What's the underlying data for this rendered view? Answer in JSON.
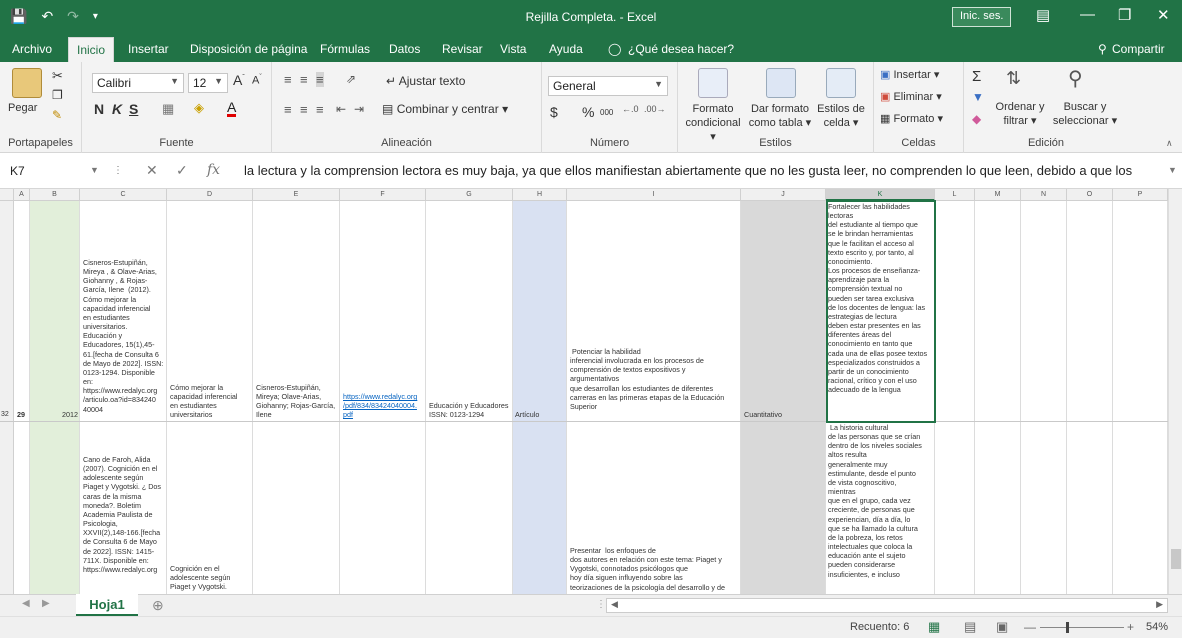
{
  "window": {
    "title": "Rejilla Completa. - Excel",
    "signin": "Inic. ses.",
    "share": "Compartir"
  },
  "tabs": [
    "Archivo",
    "Inicio",
    "Insertar",
    "Disposición de página",
    "Fórmulas",
    "Datos",
    "Revisar",
    "Vista",
    "Ayuda"
  ],
  "tellme": "¿Qué desea hacer?",
  "ribbon": {
    "clipboard": {
      "paste": "Pegar",
      "label": "Portapapeles"
    },
    "font": {
      "name": "Calibri",
      "size": "12",
      "bold": "N",
      "italic": "K",
      "underline": "S",
      "label": "Fuente"
    },
    "alignment": {
      "wrap": "Ajustar texto",
      "merge": "Combinar y centrar",
      "label": "Alineación"
    },
    "number": {
      "format": "General",
      "currency": "$",
      "percent": "%",
      "thousands": "000",
      "label": "Número"
    },
    "styles": {
      "cond1": "Formato",
      "cond2": "condicional",
      "table1": "Dar formato",
      "table2": "como tabla",
      "cell1": "Estilos de",
      "cell2": "celda",
      "label": "Estilos"
    },
    "cells": {
      "insert": "Insertar",
      "delete": "Eliminar",
      "format": "Formato",
      "label": "Celdas"
    },
    "editing": {
      "sort1": "Ordenar y",
      "sort2": "filtrar",
      "find1": "Buscar y",
      "find2": "seleccionar",
      "label": "Edición"
    }
  },
  "formula_bar": {
    "cell": "K7",
    "content": "la lectura y la comprension lectora es muy baja, ya que ellos manifiestan abiertamente que no les gusta leer, no comprenden lo que leen, debido a que los"
  },
  "columns": [
    "A",
    "B",
    "C",
    "D",
    "E",
    "F",
    "G",
    "H",
    "I",
    "J",
    "K",
    "L",
    "M",
    "N",
    "O",
    "P"
  ],
  "rows": [
    {
      "row_num": "32",
      "a": "29",
      "b": "2012",
      "c": "Cisneros-Estupiñán,\nMireya , & Olave-Arias,\nGiohanny , & Rojas-\nGarcía, Ilene  (2012).\nCómo mejorar la\ncapacidad inferencial\nen estudiantes\nuniversitarios.\nEducación y\nEducadores, 15(1),45-\n61.[fecha de Consulta 6\nde Mayo de 2022]. ISSN:\n0123-1294. Disponible\nen:\nhttps://www.redalyc.org\n/articulo.oa?id=834240\n40004",
      "d": "Cómo mejorar la\ncapacidad inferencial\nen estudiantes\nuniversitarios",
      "e": "Cisneros-Estupiñán,\nMireya; Olave-Arias,\nGiohanny; Rojas-García,\nIlene",
      "f": "https://www.redalyc.org\n/pdf/834/83424040004.\npdf",
      "g": "Educación y Educadores\nISSN: 0123-1294",
      "h": "Artículo",
      "i": " Potenciar la habilidad\ninferencial involucrada en los procesos de\ncomprensión de textos expositivos y\nargumentativos\nque desarrollan los estudiantes de diferentes\ncarreras en las primeras etapas de la Educación\nSuperior",
      "j": "Cuantitativo",
      "k": "Fortalecer las habilidades\nlectoras\ndel estudiante al tiempo que\nse le brindan herramientas\nque le facilitan el acceso al\ntexto escrito y, por tanto, al\nconocimiento.\nLos procesos de enseñanza-\naprendizaje para la\ncomprensión textual no\npueden ser tarea exclusiva\nde los docentes de lengua: las\nestrategias de lectura\ndeben estar presentes en las\ndiferentes áreas del\nconocimiento en tanto que\ncada una de ellas posee textos\nespecializados construidos a\npartir de un conocimiento\nracional, crítico y con el uso\nadecuado de la lengua"
    },
    {
      "c": "Cano de Faroh, Alida\n(2007). Cognición en el\nadolescente según\nPiaget y Vygotski. ¿ Dos\ncaras de la misma\nmoneda?. Boletim\nAcademia Paulista de\nPsicologia,\nXXVII(2),148-166.[fecha\nde Consulta 6 de Mayo\nde 2022]. ISSN: 1415-\n711X. Disponible en:\nhttps://www.redalyc.org",
      "d": "Cognición en el\nadolescente según\nPiaget y Vygotski.",
      "i": "Presentar  los enfoques de\ndos autores en relación con este tema: Piaget y\nVygotski, connotados psicólogos que\nhoy día siguen influyendo sobre las\nteorizaciones de la psicología del desarrollo y de",
      "k": " La historia cultural\nde las personas que se crían\ndentro de los niveles sociales\naltos resulta\ngeneralmente muy\nestimulante, desde el punto\nde vista cognoscitivo,\nmientras\nque en el grupo, cada vez\ncreciente, de personas que\nexperiencian, día a día, lo\nque se ha llamado la cultura\nde la pobreza, los retos\nintelectuales que coloca la\neducación ante el sujeto\npueden considerarse\ninsuficientes, e incluso"
    }
  ],
  "sheet": {
    "name": "Hoja1"
  },
  "status": {
    "count": "Recuento: 6",
    "zoom": "54%"
  },
  "colors": {
    "excel_green": "#217346",
    "col_b_fill": "#e2efda",
    "col_h_fill": "#d9e1f2",
    "col_j_fill": "#d9d9d9"
  }
}
